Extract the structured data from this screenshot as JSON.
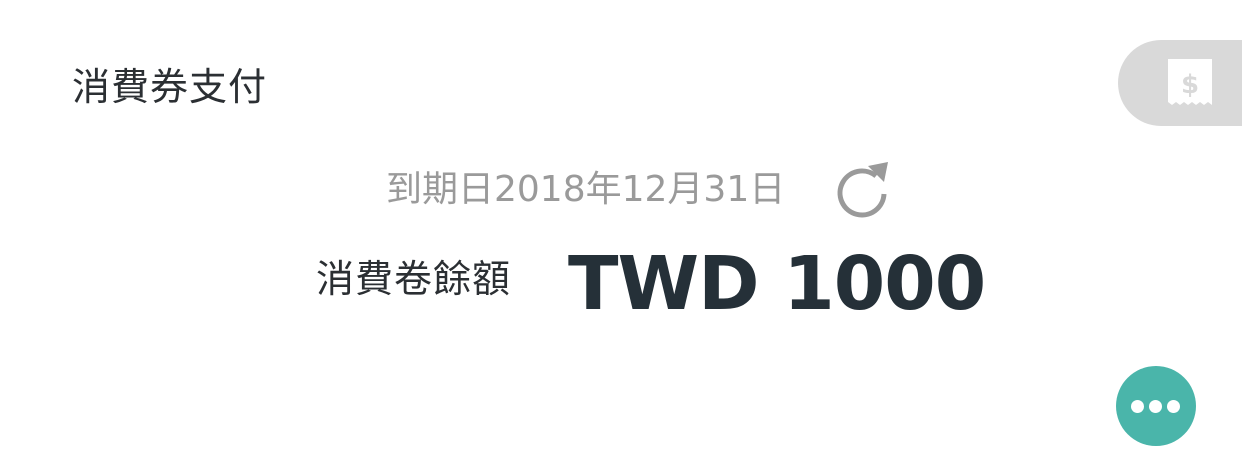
{
  "header": {
    "title": "消費券支付",
    "receipt_icon": "receipt-dollar-icon"
  },
  "voucher": {
    "expiry_text": "到期日2018年12月31日",
    "refresh_icon": "refresh-icon",
    "balance_label": "消費卷餘額",
    "balance_amount": "TWD 1000"
  },
  "fab": {
    "icon": "more-dots-icon"
  },
  "colors": {
    "title_text": "#2b2f33",
    "muted_text": "#9a9a9a",
    "amount_text": "#253038",
    "tab_bg": "#d9d9d9",
    "fab_bg": "#4ab5aa"
  }
}
